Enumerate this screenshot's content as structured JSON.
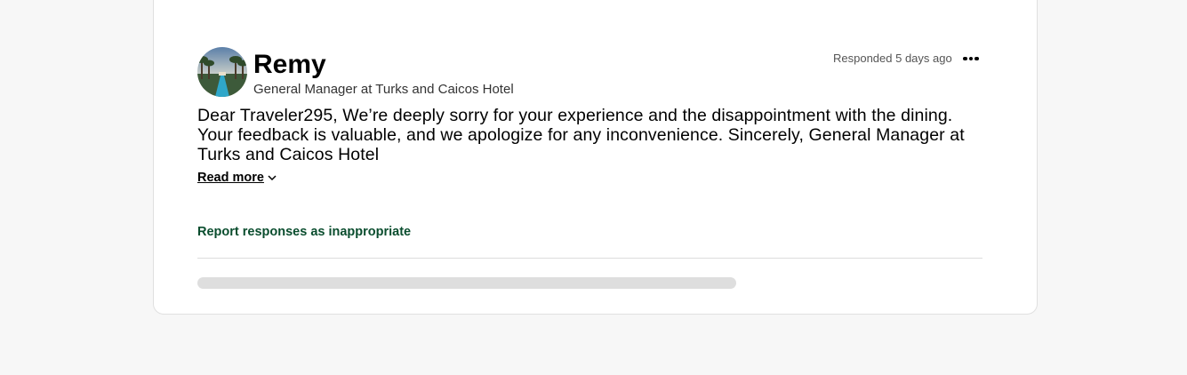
{
  "response": {
    "author_name": "Remy",
    "author_role": "General Manager at Turks and Caicos Hotel",
    "responded": "Responded 5 days ago",
    "body": "Dear Traveler295, We’re deeply sorry for your experience and the disappointment with the dining. Your feedback is valuable, and we apologize for any inconvenience. Sincerely, General Manager at Turks and Caicos Hotel",
    "read_more_label": "Read more",
    "report_label": "Report responses as inappropriate",
    "more_options_icon": "ellipsis-icon"
  },
  "colors": {
    "report_link": "#0a4d2e",
    "skeleton": "#dedede",
    "card_border": "#e0e0e0"
  }
}
